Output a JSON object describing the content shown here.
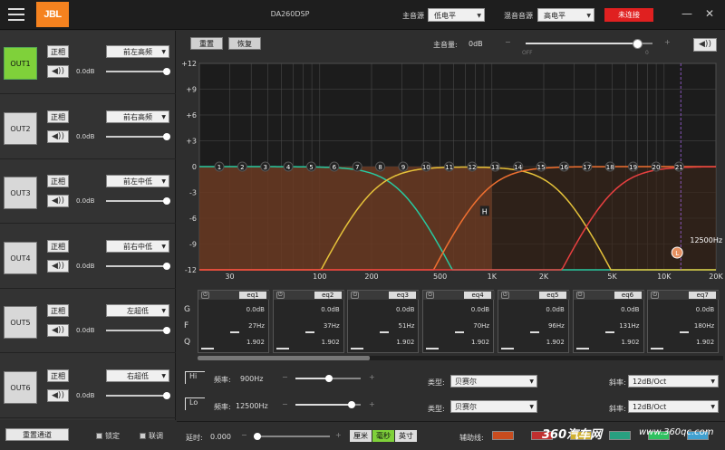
{
  "header": {
    "logo": "JBL",
    "model": "DA260DSP",
    "main_source_label": "主音源",
    "main_source_value": "低电平",
    "mix_source_label": "混音音源",
    "mix_source_value": "高电平",
    "connect_status": "未连接",
    "minimize": "—",
    "close": "✕"
  },
  "channels": [
    {
      "out": "OUT1",
      "phase": "正相",
      "position": "前左高频",
      "gain": "0.0dB",
      "active": true
    },
    {
      "out": "OUT2",
      "phase": "正相",
      "position": "前右高频",
      "gain": "0.0dB",
      "active": false
    },
    {
      "out": "OUT3",
      "phase": "正相",
      "position": "前左中低",
      "gain": "0.0dB",
      "active": false
    },
    {
      "out": "OUT4",
      "phase": "正相",
      "position": "前右中低",
      "gain": "0.0dB",
      "active": false
    },
    {
      "out": "OUT5",
      "phase": "正相",
      "position": "左超低",
      "gain": "0.0dB",
      "active": false
    },
    {
      "out": "OUT6",
      "phase": "正相",
      "position": "右超低",
      "gain": "0.0dB",
      "active": false
    }
  ],
  "left_bottom": {
    "reset_channel": "重置通道",
    "lock": "锁定",
    "link": "联调"
  },
  "eq_toolbar": {
    "reset": "重置",
    "restore": "恢复",
    "master_label": "主音量:",
    "master_value": "0dB",
    "off": "OFF",
    "zero": "0",
    "minus": "−",
    "plus": "+"
  },
  "graph": {
    "y_ticks": [
      "+12",
      "+9",
      "+6",
      "+3",
      "0",
      "-3",
      "-6",
      "-9",
      "-12"
    ],
    "x_ticks": [
      "30",
      "100",
      "200",
      "500",
      "1K",
      "2K",
      "5K",
      "10K",
      "20K"
    ],
    "x_tick_values": [
      30,
      100,
      200,
      500,
      1000,
      2000,
      5000,
      10000,
      20000
    ],
    "points": [
      "1",
      "2",
      "3",
      "4",
      "5",
      "6",
      "7",
      "8",
      "9",
      "10",
      "11",
      "12",
      "13",
      "14",
      "15",
      "16",
      "17",
      "18",
      "19",
      "20",
      "21"
    ],
    "h_marker": "H",
    "l_marker": "L",
    "l_freq": "12500Hz"
  },
  "bands": [
    {
      "name": "eq1",
      "gain": "0.0dB",
      "freq": "27Hz",
      "q": "1.902"
    },
    {
      "name": "eq2",
      "gain": "0.0dB",
      "freq": "37Hz",
      "q": "1.902"
    },
    {
      "name": "eq3",
      "gain": "0.0dB",
      "freq": "51Hz",
      "q": "1.902"
    },
    {
      "name": "eq4",
      "gain": "0.0dB",
      "freq": "70Hz",
      "q": "1.902"
    },
    {
      "name": "eq5",
      "gain": "0.0dB",
      "freq": "96Hz",
      "q": "1.902"
    },
    {
      "name": "eq6",
      "gain": "0.0dB",
      "freq": "131Hz",
      "q": "1.902"
    },
    {
      "name": "eq7",
      "gain": "0.0dB",
      "freq": "180Hz",
      "q": "1.902"
    }
  ],
  "band_rows": {
    "g": "G",
    "f": "F",
    "q": "Q"
  },
  "filters": {
    "hi": {
      "label": "Hi",
      "freq_label": "频率:",
      "freq": "900Hz",
      "type_label": "类型:",
      "type": "贝赛尔",
      "slope_label": "斜率:",
      "slope": "12dB/Oct"
    },
    "lo": {
      "label": "Lo",
      "freq_label": "频率:",
      "freq": "12500Hz",
      "type_label": "类型:",
      "type": "贝赛尔",
      "slope_label": "斜率:",
      "slope": "12dB/Oct"
    }
  },
  "bottom": {
    "delay_label": "延时:",
    "delay_value": "0.000",
    "units": [
      "厘米",
      "毫秒",
      "英寸"
    ],
    "aux_label": "辅助线:",
    "watermark": "360汽车网",
    "watermark_url": "www.360qc.com"
  },
  "colors": {
    "active": "#7fd13a",
    "curve_green": "#28c9a0",
    "curve_yellow": "#e5c23a",
    "curve_orange": "#f07030",
    "curve_red": "#e84040",
    "fill": "#6a3a22"
  }
}
